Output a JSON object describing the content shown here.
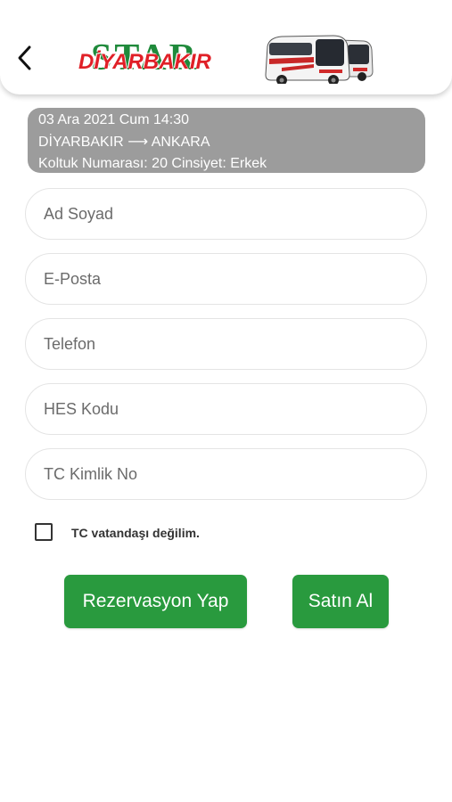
{
  "header": {
    "brand_top": "STAR",
    "brand_city": "DİYARBAKIR",
    "brand_color_green": "#1f8a3b",
    "brand_color_red": "#e02027"
  },
  "trip": {
    "datetime": "03 Ara 2021 Cum 14:30",
    "from": "DİYARBAKIR",
    "arrow": "⟶",
    "to": "ANKARA",
    "seat_label": "Koltuk Numarası:",
    "seat_number": "20",
    "gender_label": "Cinsiyet:",
    "gender": "Erkek"
  },
  "form": {
    "name_placeholder": "Ad Soyad",
    "email_placeholder": "E-Posta",
    "phone_placeholder": "Telefon",
    "hes_placeholder": "HES Kodu",
    "tc_placeholder": "TC Kimlik No",
    "not_citizen_label": "TC vatandaşı değilim."
  },
  "actions": {
    "reserve_label": "Rezervasyon Yap",
    "buy_label": "Satın Al",
    "button_color": "#299a3e"
  }
}
